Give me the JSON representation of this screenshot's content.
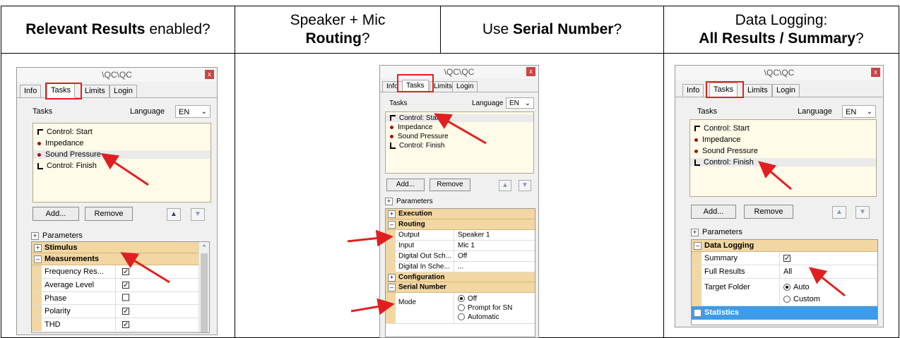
{
  "headers": {
    "col1": {
      "bold": "Relevant Results",
      "rest": " enabled?"
    },
    "col2a": {
      "line1": "Speaker + Mic",
      "bold": "Routing",
      "rest": "?"
    },
    "col2b": {
      "pre": "Use ",
      "bold": "Serial Number",
      "rest": "?"
    },
    "col3": {
      "line1": "Data Logging:",
      "bold": "All Results / Summary",
      "rest": "?"
    }
  },
  "window": {
    "title": "\\QC\\QC",
    "close": "x",
    "tabs": [
      "Info",
      "Tasks",
      "Limits",
      "Login"
    ],
    "tasks_label": "Tasks",
    "language_label": "Language",
    "language_value": "EN",
    "task_items": [
      "Control: Start",
      "Impedance",
      "Sound Pressure",
      "Control: Finish"
    ],
    "add_button": "Add...",
    "remove_button": "Remove",
    "parameters_label": "Parameters"
  },
  "panel1": {
    "categories": {
      "stimulus": "Stimulus",
      "measurements": "Measurements"
    },
    "props": [
      {
        "name": "Frequency Res...",
        "checked": true
      },
      {
        "name": "Average Level",
        "checked": true
      },
      {
        "name": "Phase",
        "checked": false
      },
      {
        "name": "Polarity",
        "checked": true
      },
      {
        "name": "THD",
        "checked": true
      }
    ]
  },
  "panel2": {
    "categories": {
      "execution": "Execution",
      "routing": "Routing",
      "configuration": "Configuration",
      "serial": "Serial Number"
    },
    "routing": [
      {
        "name": "Output",
        "value": "Speaker 1"
      },
      {
        "name": "Input",
        "value": "Mic 1"
      },
      {
        "name": "Digital Out Sch...",
        "value": "Off"
      },
      {
        "name": "Digital In Sche...",
        "value": "..."
      }
    ],
    "mode_label": "Mode",
    "mode_options": [
      "Off",
      "Prompt for SN",
      "Automatic"
    ]
  },
  "panel3": {
    "categories": {
      "logging": "Data Logging",
      "statistics": "Statistics"
    },
    "summary_label": "Summary",
    "full_results_label": "Full Results",
    "full_results_value": "All",
    "target_label": "Target Folder",
    "target_options": [
      "Auto",
      "Custom"
    ]
  }
}
